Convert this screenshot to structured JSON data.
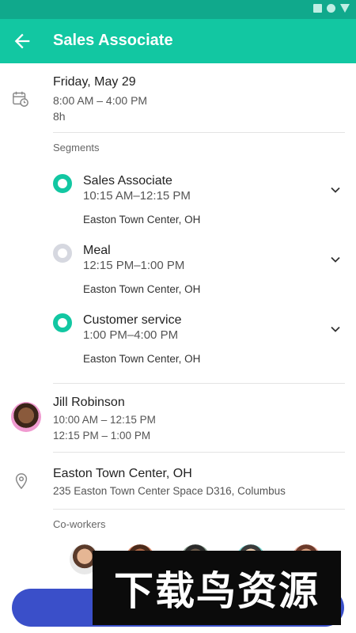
{
  "app": {
    "title": "Sales Associate"
  },
  "shift": {
    "date": "Friday, May 29",
    "time": "8:00 AM – 4:00 PM",
    "duration": "8h"
  },
  "segments": {
    "label": "Segments",
    "items": [
      {
        "title": "Sales Associate",
        "time": "10:15 AM–12:15 PM",
        "location": "Easton Town Center, OH",
        "status_color": "#12c7a2"
      },
      {
        "title": "Meal",
        "time": "12:15 PM–1:00 PM",
        "location": "Easton Town Center, OH",
        "status_color": "#d6d8e0"
      },
      {
        "title": "Customer service",
        "time": "1:00 PM–4:00 PM",
        "location": "Easton Town Center, OH",
        "status_color": "#12c7a2"
      }
    ]
  },
  "assignee": {
    "name": "Jill Robinson",
    "times": [
      "10:00 AM – 12:15 PM",
      "12:15 PM – 1:00 PM"
    ]
  },
  "location": {
    "name": "Easton Town Center, OH",
    "address": "235 Easton Town Center Space D316, Columbus"
  },
  "coworkers": {
    "label": "Co-workers"
  },
  "watermark": {
    "text": "下载鸟资源"
  },
  "colors": {
    "header": "#12c7a2",
    "statusbar": "#10a98c",
    "button": "#3a4fc9"
  }
}
